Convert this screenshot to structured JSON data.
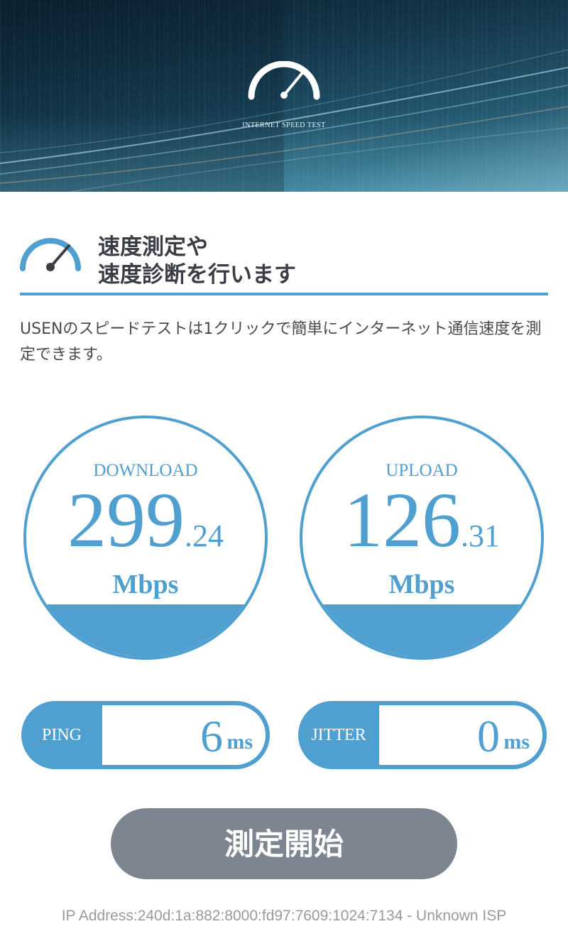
{
  "hero": {
    "caption": "INTERNET SPEED TEST",
    "icon": "speedometer-icon"
  },
  "section": {
    "icon": "speedometer-icon",
    "title_line1": "速度測定や",
    "title_line2": "速度診断を行います",
    "description": "USENのスピードテストは1クリックで簡単にインターネット通信速度を測定できます。"
  },
  "results": {
    "download": {
      "label": "DOWNLOAD",
      "int": "299",
      "dec": ".24",
      "unit": "Mbps",
      "fill_fraction": 0.22
    },
    "upload": {
      "label": "UPLOAD",
      "int": "126",
      "dec": ".31",
      "unit": "Mbps",
      "fill_fraction": 0.22
    },
    "ping": {
      "label": "PING",
      "value": "6",
      "unit": "ms"
    },
    "jitter": {
      "label": "JITTER",
      "value": "0",
      "unit": "ms"
    }
  },
  "start_button": {
    "label": "測定開始"
  },
  "footer": {
    "ip_text": "IP Address:240d:1a:882:8000:fd97:7609:1024:7134 - Unknown ISP"
  },
  "colors": {
    "accent": "#4f9fd0",
    "button": "#7d8591",
    "heading": "#3a3d45",
    "footer_text": "#9a9a9a"
  }
}
